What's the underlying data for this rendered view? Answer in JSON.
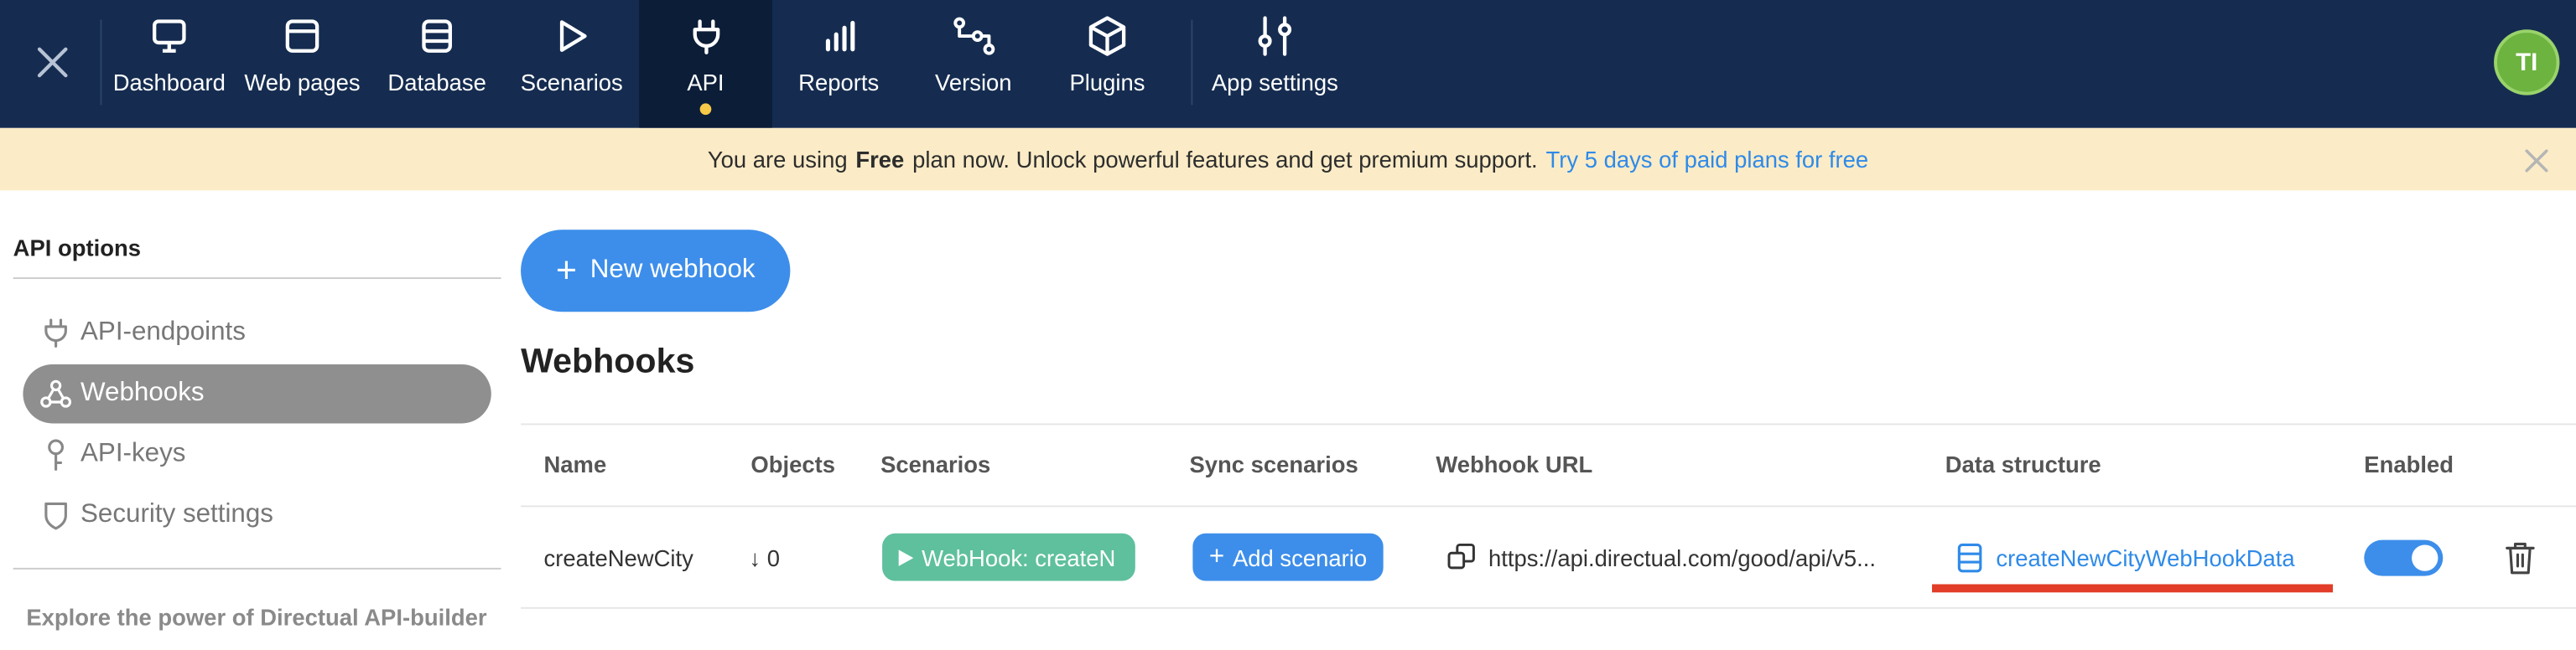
{
  "nav": {
    "items": [
      {
        "label": "Dashboard",
        "icon": "monitor-icon"
      },
      {
        "label": "Web pages",
        "icon": "browser-window-icon"
      },
      {
        "label": "Database",
        "icon": "database-icon"
      },
      {
        "label": "Scenarios",
        "icon": "play-icon"
      },
      {
        "label": "API",
        "icon": "plug-icon",
        "active": true
      },
      {
        "label": "Reports",
        "icon": "bar-chart-icon"
      },
      {
        "label": "Version",
        "icon": "branch-icon"
      },
      {
        "label": "Plugins",
        "icon": "cube-icon"
      },
      {
        "label": "App settings",
        "icon": "sliders-icon"
      }
    ],
    "avatar": "TI"
  },
  "banner": {
    "prefix": "You are using",
    "plan": "Free",
    "suffix": "plan now. Unlock powerful features and get premium support.",
    "link": "Try 5 days of paid plans for free"
  },
  "sidebar": {
    "title": "API options",
    "items": [
      {
        "label": "API-endpoints",
        "icon": "plug-icon"
      },
      {
        "label": "Webhooks",
        "icon": "webhook-icon",
        "active": true
      },
      {
        "label": "API-keys",
        "icon": "key-icon"
      },
      {
        "label": "Security settings",
        "icon": "shield-icon"
      }
    ],
    "explore": "Explore the power of Directual API-builder"
  },
  "main": {
    "new_button": "New webhook",
    "title": "Webhooks",
    "columns": [
      "Name",
      "Objects",
      "Scenarios",
      "Sync scenarios",
      "Webhook URL",
      "Data structure",
      "Enabled"
    ],
    "rows": [
      {
        "name": "createNewCity",
        "objects": "↓ 0",
        "scenario": "WebHook: createN",
        "sync": "Add scenario",
        "url": "https://api.directual.com/good/api/v5...",
        "data_structure": "createNewCityWebHookData",
        "enabled": true
      }
    ]
  },
  "colors": {
    "nav_bg": "#152c50",
    "accent": "#3d8eea",
    "banner_bg": "#fbecc7",
    "scenario_pill": "#5fc09d",
    "highlight": "#e23d28"
  }
}
